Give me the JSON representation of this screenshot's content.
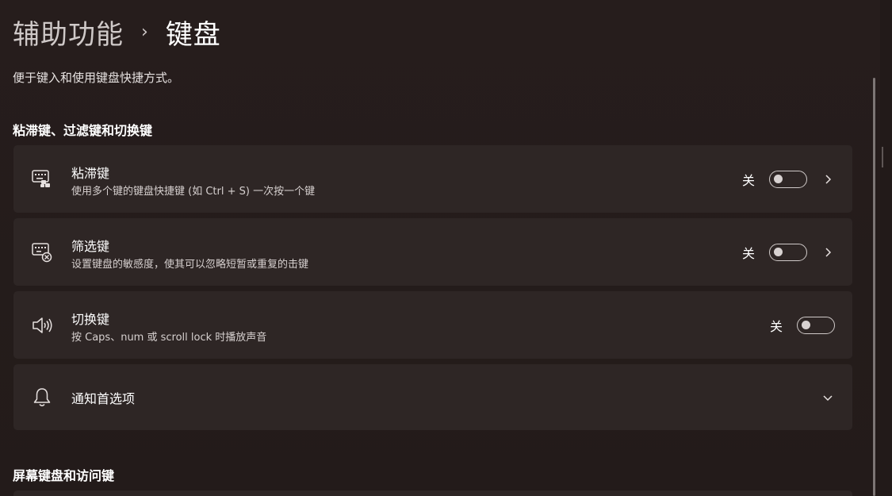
{
  "breadcrumb": {
    "parent": "辅助功能",
    "separator": "›",
    "current": "键盘"
  },
  "description": "便于键入和使用键盘快捷方式。",
  "sections": {
    "sticky_filter_toggle": "粘滞键、过滤键和切换键",
    "onscreen_access": "屏幕键盘和访问键"
  },
  "cards": {
    "sticky_keys": {
      "title": "粘滞键",
      "subtitle": "使用多个键的键盘快捷键 (如 Ctrl + S) 一次按一个键",
      "toggle_label": "关",
      "toggle_on": false,
      "icon": "keyboard-sticky-icon"
    },
    "filter_keys": {
      "title": "筛选键",
      "subtitle": "设置键盘的敏感度，使其可以忽略短暂或重复的击键",
      "toggle_label": "关",
      "toggle_on": false,
      "icon": "keyboard-filter-icon"
    },
    "toggle_keys": {
      "title": "切换键",
      "subtitle": "按 Caps、num 或 scroll lock 时播放声音",
      "toggle_label": "关",
      "toggle_on": false,
      "icon": "speaker-icon"
    },
    "notification_prefs": {
      "title": "通知首选项",
      "icon": "bell-icon"
    }
  },
  "colors": {
    "background": "#241c1b",
    "card": "#2e2625",
    "text_primary": "#ffffff",
    "text_secondary": "#d6d0cf"
  }
}
